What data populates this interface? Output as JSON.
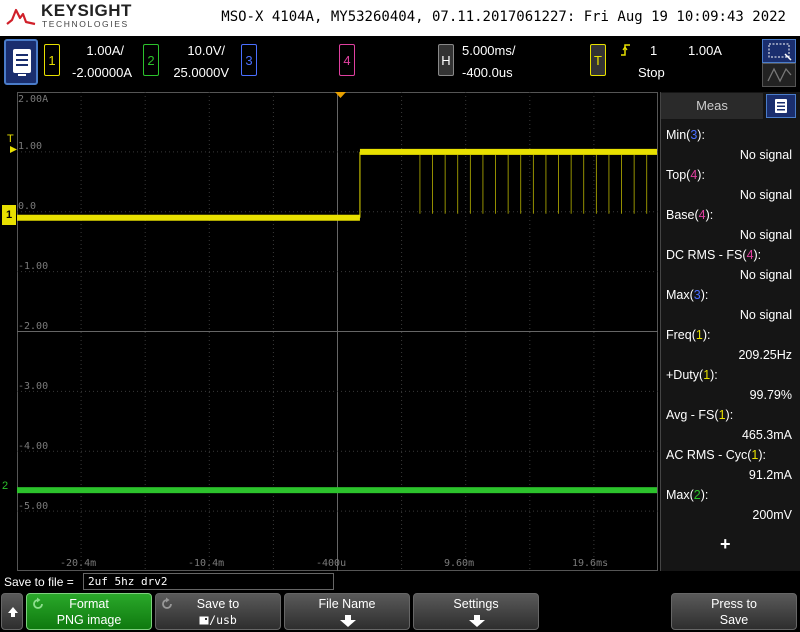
{
  "header": {
    "brand_name": "KEYSIGHT",
    "brand_sub": "TECHNOLOGIES",
    "info": "MSO-X 4104A, MY53260404, 07.11.2017061227: Fri Aug 19 10:09:43 2022"
  },
  "channels": {
    "ch1": {
      "num": "1",
      "scale": "1.00A/",
      "offset": "-2.00000A",
      "color": "#e8e000"
    },
    "ch2": {
      "num": "2",
      "scale": "10.0V/",
      "offset": "25.0000V",
      "color": "#2cc22c"
    },
    "ch3": {
      "num": "3",
      "color": "#4a6fff"
    },
    "ch4": {
      "num": "4",
      "color": "#e040a0"
    }
  },
  "horizontal": {
    "badge": "H",
    "timebase": "5.000ms/",
    "delay": "-400.0us"
  },
  "trigger": {
    "badge": "T",
    "source": "1",
    "level": "1.00A",
    "state": "Stop"
  },
  "grid": {
    "y_labels": [
      "2.00A",
      "1.00",
      "0.0",
      "-1.00",
      "-2.00",
      "-3.00",
      "-4.00",
      "-5.00"
    ],
    "x_labels": [
      "-20.4m",
      "-10.4m",
      "-400u",
      "9.60m",
      "19.6ms"
    ],
    "marker_t": "T",
    "marker_1": "1",
    "marker_2": "2"
  },
  "waveforms": {
    "ch1_levels_divs": {
      "low": -0.1,
      "high": 1.0,
      "step_at_div": 5.35
    },
    "ch2_level_div": -4.65
  },
  "meas": {
    "title": "Meas",
    "add_symbol": "+",
    "items": [
      {
        "name": "Min",
        "ch": "3",
        "ch_color": "#4a6fff",
        "value": "No signal"
      },
      {
        "name": "Top",
        "ch": "4",
        "ch_color": "#e040a0",
        "value": "No signal"
      },
      {
        "name": "Base",
        "ch": "4",
        "ch_color": "#e040a0",
        "value": "No signal"
      },
      {
        "name": "DC RMS - FS",
        "ch": "4",
        "ch_color": "#e040a0",
        "value": "No signal"
      },
      {
        "name": "Max",
        "ch": "3",
        "ch_color": "#4a6fff",
        "value": "No signal"
      },
      {
        "name": "Freq",
        "ch": "1",
        "ch_color": "#e8e000",
        "value": "209.25Hz"
      },
      {
        "name": "+Duty",
        "ch": "1",
        "ch_color": "#e8e000",
        "value": "99.79%"
      },
      {
        "name": "Avg - FS",
        "ch": "1",
        "ch_color": "#e8e000",
        "value": "465.3mA"
      },
      {
        "name": "AC RMS - Cyc",
        "ch": "1",
        "ch_color": "#e8e000",
        "value": "91.2mA"
      },
      {
        "name": "Max",
        "ch": "2",
        "ch_color": "#2cc22c",
        "value": "200mV"
      }
    ]
  },
  "save": {
    "label": "Save to file =",
    "filename": "2uf 5hz drv2"
  },
  "softkeys": {
    "format_l1": "Format",
    "format_l2": "PNG image",
    "saveto_l1": "Save to",
    "saveto_l2": "/usb",
    "filename_l1": "File Name",
    "settings_l1": "Settings",
    "press_l1": "Press to",
    "press_l2": "Save"
  }
}
